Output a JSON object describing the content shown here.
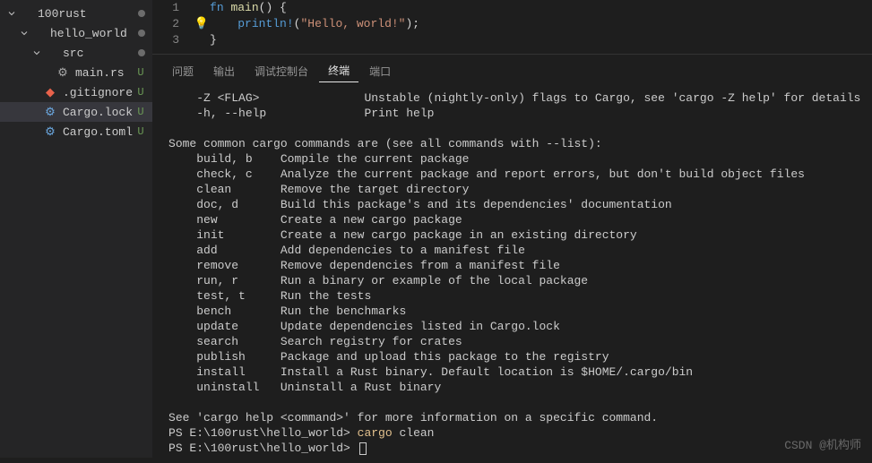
{
  "sidebar": {
    "items": [
      {
        "label": "100rust",
        "kind": "folder-open-root",
        "indent": "indent0",
        "chevron": "down",
        "status": "dot"
      },
      {
        "label": "hello_world",
        "kind": "folder-open",
        "indent": "indent1",
        "chevron": "down",
        "status": "dot"
      },
      {
        "label": "src",
        "kind": "folder-open",
        "indent": "indent2",
        "chevron": "down",
        "status": "dot"
      },
      {
        "label": "main.rs",
        "kind": "rust",
        "indent": "indent3",
        "chevron": "",
        "status": "U"
      },
      {
        "label": ".gitignore",
        "kind": "git",
        "indent": "indent2",
        "chevron": "",
        "status": "U"
      },
      {
        "label": "Cargo.lock",
        "kind": "gear",
        "indent": "indent2",
        "chevron": "",
        "status": "U",
        "selected": true
      },
      {
        "label": "Cargo.toml",
        "kind": "gear",
        "indent": "indent2",
        "chevron": "",
        "status": "U"
      }
    ]
  },
  "editor": {
    "lines": [
      {
        "n": "1",
        "html": "<span class='kw'>fn</span> <span class='fn'>main</span><span class='punct'>() {</span>"
      },
      {
        "n": "2",
        "bulb": true,
        "html": "    <span class='mac'>println!</span><span class='punct'>(</span><span class='str'>\"Hello, world!\"</span><span class='punct'>);</span>"
      },
      {
        "n": "3",
        "html": "<span class='punct'>}</span>"
      }
    ]
  },
  "panel": {
    "tabs": [
      "问题",
      "输出",
      "调试控制台",
      "终端",
      "端口"
    ],
    "active": 3
  },
  "terminal": {
    "raw": "    -Z <FLAG>               Unstable (nightly-only) flags to Cargo, see 'cargo -Z help' for details\n    -h, --help              Print help\n\nSome common cargo commands are (see all commands with --list):\n    build, b    Compile the current package\n    check, c    Analyze the current package and report errors, but don't build object files\n    clean       Remove the target directory\n    doc, d      Build this package's and its dependencies' documentation\n    new         Create a new cargo package\n    init        Create a new cargo package in an existing directory\n    add         Add dependencies to a manifest file\n    remove      Remove dependencies from a manifest file\n    run, r      Run a binary or example of the local package\n    test, t     Run the tests\n    bench       Run the benchmarks\n    update      Update dependencies listed in Cargo.lock\n    search      Search registry for crates\n    publish     Package and upload this package to the registry\n    install     Install a Rust binary. Default location is $HOME/.cargo/bin\n    uninstall   Uninstall a Rust binary\n\nSee 'cargo help <command>' for more information on a specific command.",
    "prompt1_path": "PS E:\\100rust\\hello_world> ",
    "prompt1_cmd1": "cargo",
    "prompt1_cmd2": " clean",
    "prompt2_path": "PS E:\\100rust\\hello_world> "
  },
  "watermark": "CSDN @机构师"
}
